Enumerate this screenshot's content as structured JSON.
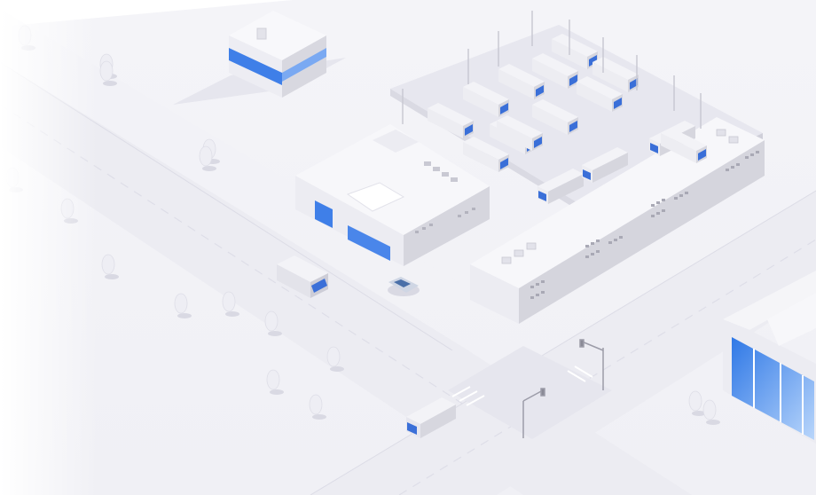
{
  "scene": {
    "kind": "isometric-logistics-illustration",
    "palette": {
      "background": "#ffffff",
      "ground": "#f2f2f6",
      "road": "#ebebf2",
      "road_edge": "#dcdce6",
      "lot": "#e4e4ec",
      "building_top": "#f7f7fa",
      "building_left": "#ededf2",
      "building_right": "#d6d6de",
      "window_blue": "#3f7fe8",
      "window_blue_light": "#8ab7f5",
      "truck_body": "#e6e6ee",
      "truck_cab_blue": "#3a6fd8",
      "tree": "#eeeef4",
      "shadow": "#d9d9e3"
    },
    "objects": {
      "office_building": "small-office-building",
      "warehouse": "central-warehouse",
      "long_depot": "long-depot-building",
      "corner_building": "glass-corner-building",
      "parked_trucks": 15,
      "moving_trucks": 2,
      "cars": 1,
      "trees": 16,
      "street_lights": 9,
      "traffic_lights": 2
    }
  }
}
